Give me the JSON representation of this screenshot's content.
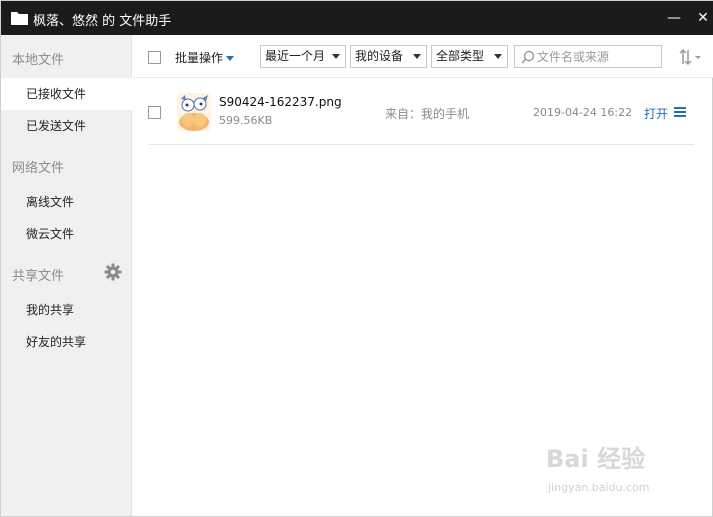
{
  "window": {
    "title": "枫落、悠然 的 文件助手",
    "minimize_label": "—",
    "close_label": "✕"
  },
  "sidebar": {
    "sections": [
      {
        "label": "本地文件",
        "items": [
          {
            "label": "已接收文件",
            "active": true
          },
          {
            "label": "已发送文件",
            "active": false
          }
        ]
      },
      {
        "label": "网络文件",
        "items": [
          {
            "label": "离线文件",
            "active": false
          },
          {
            "label": "微云文件",
            "active": false
          }
        ]
      },
      {
        "label": "共享文件",
        "items": [
          {
            "label": "我的共享",
            "active": false
          },
          {
            "label": "好友的共享",
            "active": false
          }
        ]
      }
    ]
  },
  "toolbar": {
    "batch_label": "批量操作",
    "time_filter": "最近一个月",
    "device_filter": "我的设备",
    "type_filter": "全部类型",
    "search_placeholder": "文件名或来源"
  },
  "files": [
    {
      "name": "S90424-162237.png",
      "size": "599.56KB",
      "source": "来自：我的手机",
      "date": "2019-04-24 16:22",
      "open_label": "打开"
    }
  ],
  "watermark": {
    "logo": "Bai 经验",
    "url": "jingyan.baidu.com"
  },
  "colors": {
    "titlebar": "#1b1b1b",
    "sidebar": "#f0f0f0",
    "accent": "#1e6fb6"
  }
}
